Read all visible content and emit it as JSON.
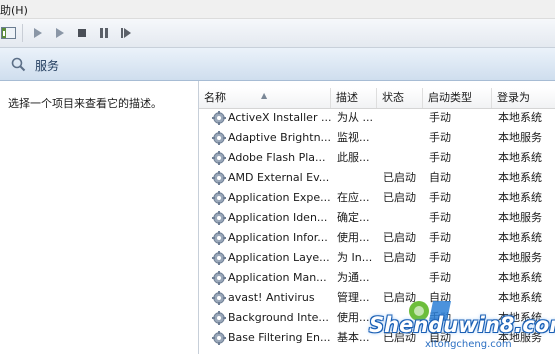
{
  "menubar": {
    "help": "助(H)"
  },
  "header": {
    "title": "服务"
  },
  "left_pane": {
    "description": "选择一个项目来查看它的描述。"
  },
  "columns": {
    "name": "名称",
    "desc": "描述",
    "status": "状态",
    "startup": "启动类型",
    "logon": "登录为"
  },
  "rows": [
    {
      "name": "ActiveX Installer ...",
      "desc": "为从 ...",
      "status": "",
      "startup": "手动",
      "logon": "本地系统"
    },
    {
      "name": "Adaptive Brightn...",
      "desc": "监视...",
      "status": "",
      "startup": "手动",
      "logon": "本地服务"
    },
    {
      "name": "Adobe Flash Pla...",
      "desc": "此服...",
      "status": "",
      "startup": "手动",
      "logon": "本地系统"
    },
    {
      "name": "AMD External Ev...",
      "desc": "",
      "status": "已启动",
      "startup": "自动",
      "logon": "本地系统"
    },
    {
      "name": "Application Expe...",
      "desc": "在应...",
      "status": "已启动",
      "startup": "手动",
      "logon": "本地系统"
    },
    {
      "name": "Application Iden...",
      "desc": "确定...",
      "status": "",
      "startup": "手动",
      "logon": "本地服务"
    },
    {
      "name": "Application Infor...",
      "desc": "使用...",
      "status": "已启动",
      "startup": "手动",
      "logon": "本地系统"
    },
    {
      "name": "Application Laye...",
      "desc": "为 In...",
      "status": "已启动",
      "startup": "手动",
      "logon": "本地服务"
    },
    {
      "name": "Application Man...",
      "desc": "为通...",
      "status": "",
      "startup": "手动",
      "logon": "本地系统"
    },
    {
      "name": "avast! Antivirus",
      "desc": "管理...",
      "status": "已启动",
      "startup": "自动",
      "logon": "本地系统"
    },
    {
      "name": "Background Inte...",
      "desc": "使用...",
      "status": "",
      "startup": "手动",
      "logon": "本地系统"
    },
    {
      "name": "Base Filtering En...",
      "desc": "基本...",
      "status": "已启动",
      "startup": "自动",
      "logon": "本地服务"
    }
  ],
  "watermark": {
    "main": "Shenduwin8.com",
    "sub": "xitongcheng.com"
  },
  "colors": {
    "header_text": "#1e395b",
    "watermark_blue": "#1a5fb4",
    "gear": "#7f8fa6"
  }
}
